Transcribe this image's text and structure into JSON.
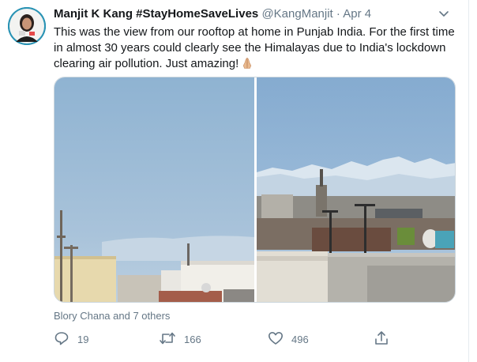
{
  "author": {
    "name": "Manjit K Kang #StayHomeSaveLives",
    "handle": "@KangManjit",
    "separator": "·",
    "date": "Apr 4"
  },
  "tweet": {
    "text": "This was the view from our rooftop at home in Punjab India. For the first time in almost 30 years could clearly see the Himalayas due to India's lockdown clearing air pollution. Just amazing!",
    "emoji_icon": "folded-hands-icon"
  },
  "liked_by": "Blory Chana and 7 others",
  "actions": {
    "reply_count": "19",
    "retweet_count": "166",
    "like_count": "496"
  },
  "icons": {
    "reply": "reply-icon",
    "retweet": "retweet-icon",
    "like": "heart-icon",
    "share": "share-icon",
    "menu": "chevron-down-icon"
  },
  "colors": {
    "text_primary": "#14171a",
    "text_secondary": "#657786",
    "border": "#ccd6dd"
  }
}
